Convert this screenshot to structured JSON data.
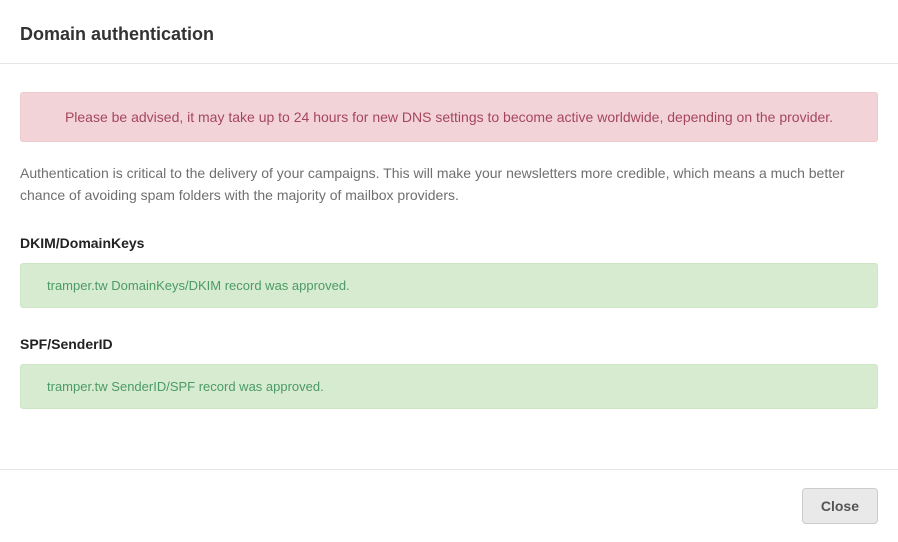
{
  "header": {
    "title": "Domain authentication"
  },
  "warning": {
    "text": "Please be advised, it may take up to 24 hours for new DNS settings to become active worldwide, depending on the provider."
  },
  "description": {
    "text": "Authentication is critical to the delivery of your campaigns. This will make your newsletters more credible, which means a much better chance of avoiding spam folders with the majority of mailbox providers."
  },
  "sections": {
    "dkim": {
      "heading": "DKIM/DomainKeys",
      "message": "tramper.tw DomainKeys/DKIM record was approved."
    },
    "spf": {
      "heading": "SPF/SenderID",
      "message": "tramper.tw SenderID/SPF record was approved."
    }
  },
  "footer": {
    "close_label": "Close"
  }
}
